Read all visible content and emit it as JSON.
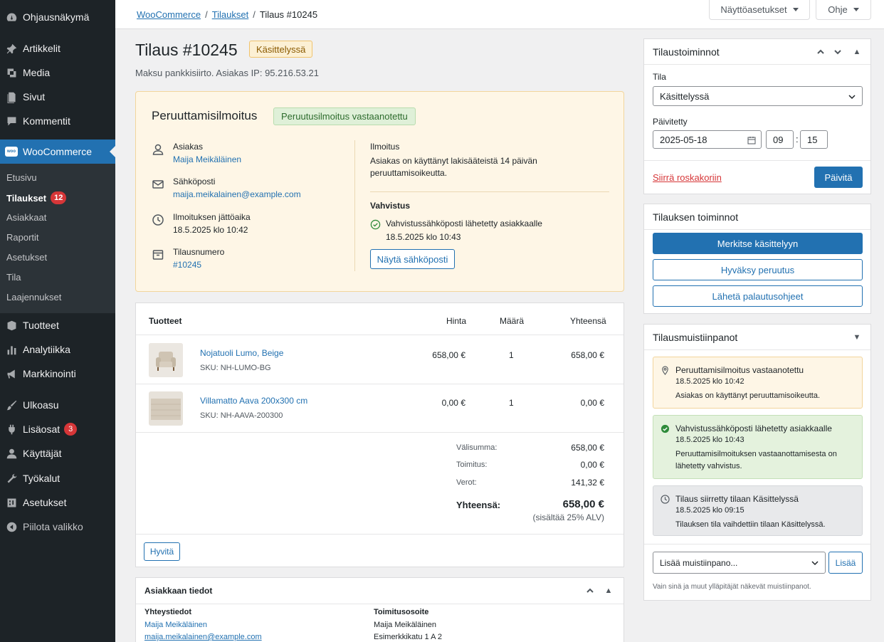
{
  "sidebar": {
    "items": [
      {
        "label": "Ohjausnäkymä",
        "icon": "dashboard-icon"
      },
      {
        "label": "Artikkelit",
        "icon": "pin-icon"
      },
      {
        "label": "Media",
        "icon": "media-icon"
      },
      {
        "label": "Sivut",
        "icon": "pages-icon"
      },
      {
        "label": "Kommentit",
        "icon": "comment-icon"
      },
      {
        "label": "WooCommerce",
        "icon": "woocommerce-icon",
        "logo_text": "woo"
      },
      {
        "label": "Tuotteet",
        "icon": "products-icon"
      },
      {
        "label": "Analytiikka",
        "icon": "analytics-icon"
      },
      {
        "label": "Markkinointi",
        "icon": "megaphone-icon"
      },
      {
        "label": "Ulkoasu",
        "icon": "brush-icon"
      },
      {
        "label": "Lisäosat",
        "icon": "plugin-icon",
        "badge": "3"
      },
      {
        "label": "Käyttäjät",
        "icon": "users-icon"
      },
      {
        "label": "Työkalut",
        "icon": "wrench-icon"
      },
      {
        "label": "Asetukset",
        "icon": "settings-icon"
      },
      {
        "label": "Piilota valikko",
        "icon": "collapse-icon"
      }
    ],
    "submenu": [
      {
        "label": "Etusivu"
      },
      {
        "label": "Tilaukset",
        "badge": "12"
      },
      {
        "label": "Asiakkaat"
      },
      {
        "label": "Raportit"
      },
      {
        "label": "Asetukset"
      },
      {
        "label": "Tila"
      },
      {
        "label": "Laajennukset"
      }
    ]
  },
  "topbar": {
    "breadcrumb": [
      "WooCommerce",
      "Tilaukset",
      "Tilaus #10245"
    ],
    "screen_options": "Näyttöasetukset",
    "help": "Ohje"
  },
  "order": {
    "title": "Tilaus #10245",
    "status": "Käsittelyssä",
    "subtitle": "Maksu pankkisiirto. Asiakas IP: 95.216.53.21"
  },
  "notice": {
    "title": "Peruuttamisilmoitus",
    "pill": "Peruutusilmoitus vastaanotettu",
    "fields": [
      {
        "label": "Asiakas",
        "value": "Maija Meikäläinen"
      },
      {
        "label": "Sähköposti",
        "value": "maija.meikalainen@example.com"
      },
      {
        "label": "Ilmoituksen jättöaika",
        "value": "18.5.2025 klo 10:42"
      },
      {
        "label": "Tilausnumero",
        "value": "#10245"
      }
    ],
    "notice_heading": "Ilmoitus",
    "notice_text_1": "Asiakas on käyttänyt lakisääteistä 14 päivän",
    "notice_text_2": "peruuttamisoikeutta.",
    "confirmation_heading": "Vahvistus",
    "confirmation_text_1": "Vahvistussähköposti lähetetty asiakkaalle",
    "confirmation_text_2": "18.5.2025 klo 10:43",
    "view_email": "Näytä sähköposti"
  },
  "items": {
    "headers": {
      "product": "Tuotteet",
      "price": "Hinta",
      "qty": "Määrä",
      "total": "Yhteensä"
    },
    "rows": [
      {
        "name": "Nojatuoli Lumo, Beige",
        "sku": "SKU: NH-LUMO-BG",
        "price": "658,00 €",
        "qty": "1",
        "total": "658,00 €"
      },
      {
        "name": "Villamatto Aava 200x300 cm",
        "sku": "SKU: NH-AAVA-200300",
        "price": "0,00 €",
        "qty": "1",
        "total": "0,00 €"
      }
    ],
    "totals": {
      "subtotal_label": "Välisumma:",
      "subtotal": "658,00 €",
      "shipping_label": "Toimitus:",
      "shipping": "0,00 €",
      "tax_label": "Verot:",
      "tax": "141,32 €",
      "total_label": "Yhteensä:",
      "total": "658,00 €",
      "vat_note": "(sisältää 25% ALV)"
    },
    "refund": "Hyvitä"
  },
  "customer": {
    "title": "Asiakkaan tiedot",
    "contact_heading": "Yhteystiedot",
    "contact_name": "Maija Meikäläinen",
    "contact_email": "maija.meikalainen@example.com",
    "shipping_heading": "Toimitusosoite",
    "shipping_name": "Maija Meikäläinen",
    "shipping_street": "Esimerkkikatu 1 A 2"
  },
  "order_actions": {
    "title": "Tilaustoiminnot",
    "status_label": "Tila",
    "status_value": "Käsittelyssä",
    "updated_label": "Päivitetty",
    "date": "2025-05-18",
    "hour": "09",
    "minute": "15",
    "time_sep": ":",
    "trash": "Siirrä roskakoriin",
    "update": "Päivitä"
  },
  "order_functions": {
    "title": "Tilauksen toiminnot",
    "mark_processed": "Merkitse käsittelyyn",
    "approve_cancel": "Hyväksy peruutus",
    "send_return": "Lähetä palautusohjeet"
  },
  "notes": {
    "title": "Tilausmuistiinpanot",
    "items": [
      {
        "title": "Peruuttamisilmoitus vastaanotettu",
        "date": "18.5.2025 klo 10:42",
        "text": "Asiakas on käyttänyt peruuttamisoikeutta.",
        "bg": "#fef6e6",
        "border": "#f2d59c"
      },
      {
        "title": "Vahvistussähköposti lähetetty asiakkaalle",
        "date": "18.5.2025 klo 10:43",
        "text": "Peruuttamisilmoituksen vastaanottamisesta on lähetetty vahvistus.",
        "bg": "#e4f2dd",
        "border": "#c4e0b8"
      },
      {
        "title": "Tilaus siirretty tilaan Käsittelyssä",
        "date": "18.5.2025 klo 09:15",
        "text": "Tilauksen tila vaihdettiin tilaan Käsittelyssä.",
        "bg": "#e8e9eb",
        "border": "#d5d7da"
      }
    ],
    "add_select": "Lisää muistiinpano...",
    "add_button": "Lisää",
    "hint": "Vain sinä ja muut ylläpitäjät näkevät muistiinpanot."
  }
}
